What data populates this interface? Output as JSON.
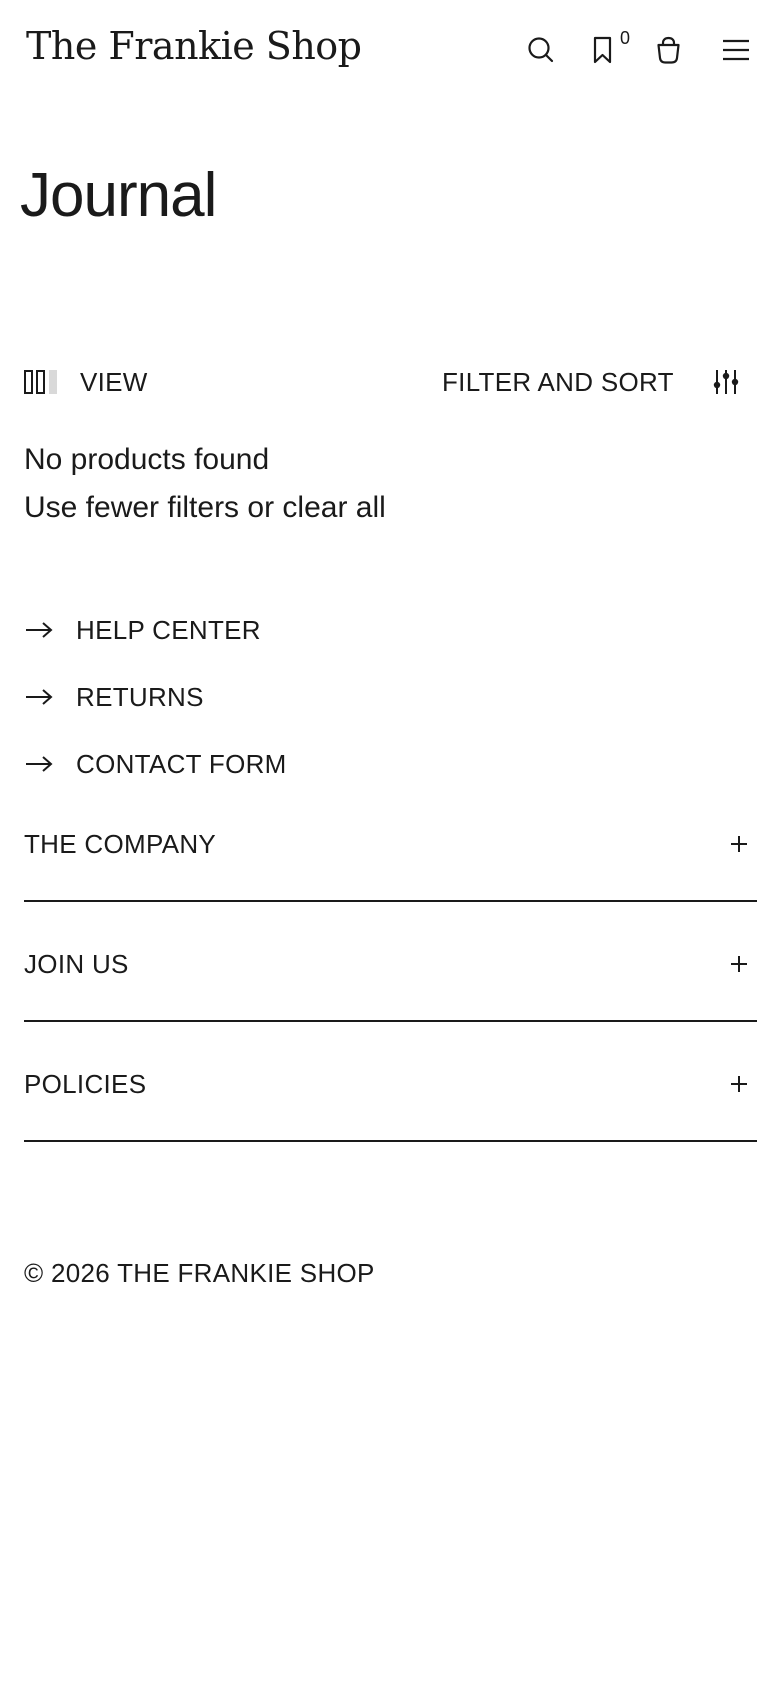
{
  "header": {
    "logo": "The Frankie Shop",
    "search_icon": "search-icon",
    "wishlist_icon": "bookmark-icon",
    "wishlist_count": "0",
    "bag_icon": "shopping-bag-icon",
    "menu_icon": "hamburger-menu-icon"
  },
  "page": {
    "title": "Journal"
  },
  "toolbar": {
    "view_icon": "grid-columns-icon",
    "view_label": "VIEW",
    "filter_label": "FILTER AND SORT",
    "filter_icon": "sliders-icon"
  },
  "empty_state": {
    "title": "No products found",
    "hint_prefix": "Use fewer filters or ",
    "clear_link": "clear all"
  },
  "help_links": [
    {
      "label": "HELP CENTER",
      "icon": "arrow-right-icon"
    },
    {
      "label": "RETURNS",
      "icon": "arrow-right-icon"
    },
    {
      "label": "CONTACT FORM",
      "icon": "arrow-right-icon"
    }
  ],
  "footer": {
    "accordions": [
      {
        "label": "THE COMPANY",
        "icon": "plus-icon"
      },
      {
        "label": "JOIN US",
        "icon": "plus-icon"
      },
      {
        "label": "POLICIES",
        "icon": "plus-icon"
      }
    ],
    "copyright": "© 2026 THE FRANKIE SHOP"
  },
  "colors": {
    "text": "#1a1a1a",
    "background": "#ffffff",
    "muted_view_column": "#d9d9d9"
  }
}
